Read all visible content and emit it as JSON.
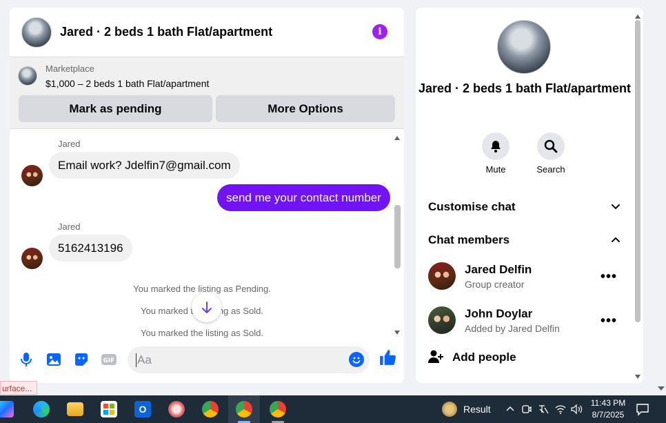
{
  "chat": {
    "title": "Jared · 2 beds 1 bath Flat/apartment",
    "marketplace_label": "Marketplace",
    "listing": "$1,000 – 2 beds 1 bath Flat/apartment",
    "mark_pending": "Mark as pending",
    "more_options": "More Options",
    "messages": [
      {
        "sender": "Jared",
        "text": "Email work? Jdelfin7@gmail.com"
      },
      {
        "text": "send me your contact number"
      },
      {
        "sender": "Jared",
        "text": "5162413196"
      }
    ],
    "system": [
      "You marked the listing as Pending.",
      "You marked the listing as Sold.",
      "You marked the listing as Sold."
    ],
    "placeholder": "Aa",
    "accent": "#7014f5"
  },
  "info": {
    "title": "Jared · 2 beds 1 bath Flat/apartment",
    "mute": "Mute",
    "search": "Search",
    "customise": "Customise chat",
    "members_header": "Chat members",
    "members": [
      {
        "name": "Jared Delfin",
        "sub": "Group creator"
      },
      {
        "name": "John Doylar",
        "sub": "Added by Jared Delfin"
      }
    ],
    "more": "•••",
    "add_people": "Add people"
  },
  "tooltip": "urface...",
  "taskbar": {
    "weather": "Result",
    "time": "11:43 PM",
    "date": "8/7/2025"
  }
}
